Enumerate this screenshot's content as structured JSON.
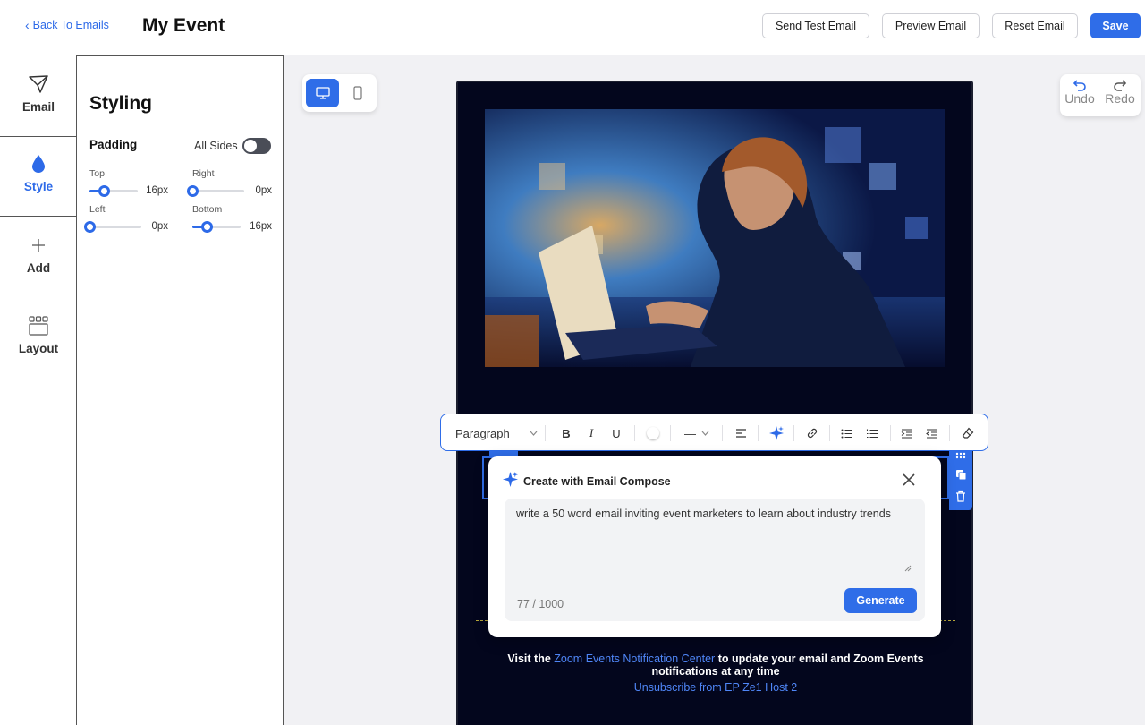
{
  "header": {
    "back_label": "Back To Emails",
    "title": "My Event",
    "buttons": {
      "send_test": "Send Test Email",
      "preview": "Preview Email",
      "reset": "Reset Email",
      "save": "Save"
    }
  },
  "rail": {
    "items": [
      {
        "label": "Email",
        "icon": "paper-plane-icon"
      },
      {
        "label": "Style",
        "icon": "droplet-icon",
        "active": true
      },
      {
        "label": "Add",
        "icon": "plus-icon"
      },
      {
        "label": "Layout",
        "icon": "layout-grid-icon"
      }
    ]
  },
  "styling": {
    "title": "Styling",
    "padding_label": "Padding",
    "all_sides_label": "All Sides",
    "all_sides_enabled": false,
    "sliders": [
      {
        "label": "Top",
        "value": "16px",
        "fraction": 0.3
      },
      {
        "label": "Right",
        "value": "0px",
        "fraction": 0.0
      },
      {
        "label": "Left",
        "value": "0px",
        "fraction": 0.0
      },
      {
        "label": "Bottom",
        "value": "16px",
        "fraction": 0.3
      }
    ]
  },
  "canvas": {
    "undo_label": "Undo",
    "redo_label": "Redo",
    "active_device": "desktop"
  },
  "toolbar": {
    "block_type": "Paragraph",
    "line_style": "—"
  },
  "compose": {
    "title": "Create with Email Compose",
    "prompt": "write a 50 word email inviting event marketers to learn about industry trends",
    "count": "77 / 1000",
    "generate_label": "Generate"
  },
  "email_footer": {
    "visit_prefix": "Visit the ",
    "notif_link": "Zoom Events Notification Center",
    "visit_suffix": " to update your email and Zoom Events notifications at any time",
    "unsubscribe": "Unsubscribe from EP Ze1 Host 2"
  },
  "colors": {
    "accent": "#2f6de8",
    "email_bg": "#03061d",
    "link": "#4f86f7"
  }
}
